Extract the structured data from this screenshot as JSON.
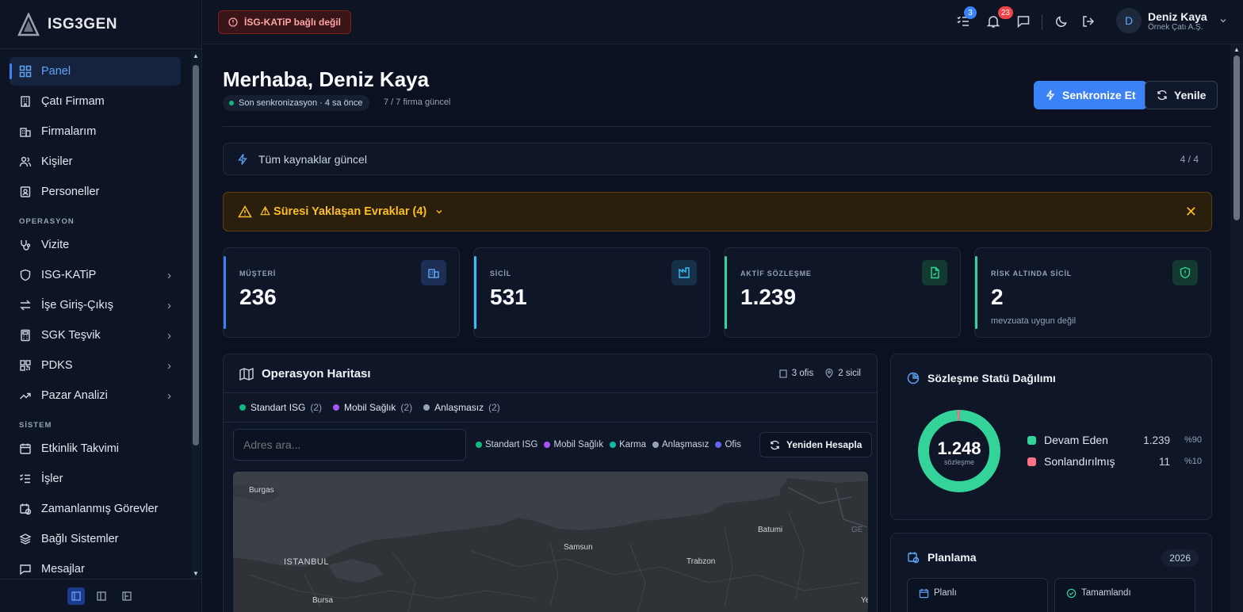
{
  "brand": {
    "name": "ISG3GEN"
  },
  "sidebar": {
    "items_top": [
      {
        "label": "Panel",
        "icon": "dashboard-icon"
      },
      {
        "label": "Çatı Firmam",
        "icon": "building-icon"
      },
      {
        "label": "Firmalarım",
        "icon": "buildings-icon"
      },
      {
        "label": "Kişiler",
        "icon": "users-icon"
      },
      {
        "label": "Personeller",
        "icon": "id-card-icon"
      }
    ],
    "section_ops": "OPERASYON",
    "items_ops": [
      {
        "label": "Vizite",
        "icon": "stethoscope-icon"
      },
      {
        "label": "ISG-KATiP",
        "icon": "shield-icon"
      },
      {
        "label": "İşe Giriş-Çıkış",
        "icon": "arrows-icon"
      },
      {
        "label": "SGK Teşvik",
        "icon": "calculator-icon"
      },
      {
        "label": "PDKS",
        "icon": "qr-icon"
      },
      {
        "label": "Pazar Analizi",
        "icon": "trend-icon"
      }
    ],
    "section_sys": "SİSTEM",
    "items_sys": [
      {
        "label": "Etkinlik Takvimi",
        "icon": "calendar-icon"
      },
      {
        "label": "İşler",
        "icon": "tasks-icon"
      },
      {
        "label": "Zamanlanmış Görevler",
        "icon": "clock-calendar-icon"
      },
      {
        "label": "Bağlı Sistemler",
        "icon": "layers-icon"
      },
      {
        "label": "Mesajlar",
        "icon": "message-icon"
      }
    ]
  },
  "topbar": {
    "katip_status": "İSG-KATiP bağlı değil",
    "tasks_badge": "3",
    "notif_badge": "23",
    "user_initial": "D",
    "user_name": "Deniz Kaya",
    "user_company": "Örnek Çatı A.Ş."
  },
  "header": {
    "greeting": "Merhaba, Deniz Kaya",
    "sync_status": "Son senkronizasyon · 4 sa önce",
    "firms_status": "7 / 7 firma güncel",
    "sync_button": "Senkronize Et",
    "refresh_button": "Yenile"
  },
  "sources": {
    "label": "Tüm kaynaklar güncel",
    "count": "4 / 4"
  },
  "alert": {
    "label": "⚠ Süresi Yaklaşan Evraklar (4)"
  },
  "kpis": [
    {
      "label": "MÜŞTERİ",
      "value": "236",
      "sub": "",
      "color": "#3b82f6"
    },
    {
      "label": "SİCİL",
      "value": "531",
      "sub": "",
      "color": "#38bdf8"
    },
    {
      "label": "AKTİF SÖZLEŞME",
      "value": "1.239",
      "sub": "",
      "color": "#34d399"
    },
    {
      "label": "RİSK ALTINDA SİCİL",
      "value": "2",
      "sub": "mevzuata uygun değil",
      "color": "#34d399"
    }
  ],
  "operation_map": {
    "title": "Operasyon Haritası",
    "offices": "3 ofis",
    "sicil": "2 sicil",
    "legend": [
      {
        "label": "Standart ISG",
        "count": "(2)",
        "color": "#10b981"
      },
      {
        "label": "Mobil Sağlık",
        "count": "(2)",
        "color": "#a855f7"
      },
      {
        "label": "Anlaşmasız",
        "count": "(2)",
        "color": "#94a3b8"
      }
    ],
    "search_placeholder": "Adres ara...",
    "legend2": [
      {
        "label": "Standart ISG",
        "color": "#10b981"
      },
      {
        "label": "Mobil Sağlık",
        "color": "#a855f7"
      },
      {
        "label": "Karma",
        "color": "#14b8a6"
      },
      {
        "label": "Anlaşmasız",
        "color": "#94a3b8"
      },
      {
        "label": "Ofis",
        "color": "#6366f1"
      }
    ],
    "recalc_button": "Yeniden Hesapla",
    "cities": [
      "Burgas",
      "Batumi",
      "GE",
      "Samsun",
      "ISTANBUL",
      "Trabzon",
      "Bursa",
      "Ye"
    ]
  },
  "contract_status": {
    "title": "Sözleşme Statü Dağılımı",
    "total": "1.248",
    "total_label": "sözleşme",
    "rows": [
      {
        "label": "Devam Eden",
        "value": "1.239",
        "pct": "%90",
        "color": "#34d399"
      },
      {
        "label": "Sonlandırılmış",
        "value": "11",
        "pct": "%10",
        "color": "#fb7185"
      }
    ]
  },
  "chart_data": {
    "type": "pie",
    "categories": [
      "Devam Eden",
      "Sonlandırılmış"
    ],
    "values": [
      1239,
      11
    ]
  },
  "planning": {
    "title": "Planlama",
    "year": "2026",
    "cards": [
      {
        "label": "Planlı"
      },
      {
        "label": "Tamamlandı"
      }
    ]
  }
}
